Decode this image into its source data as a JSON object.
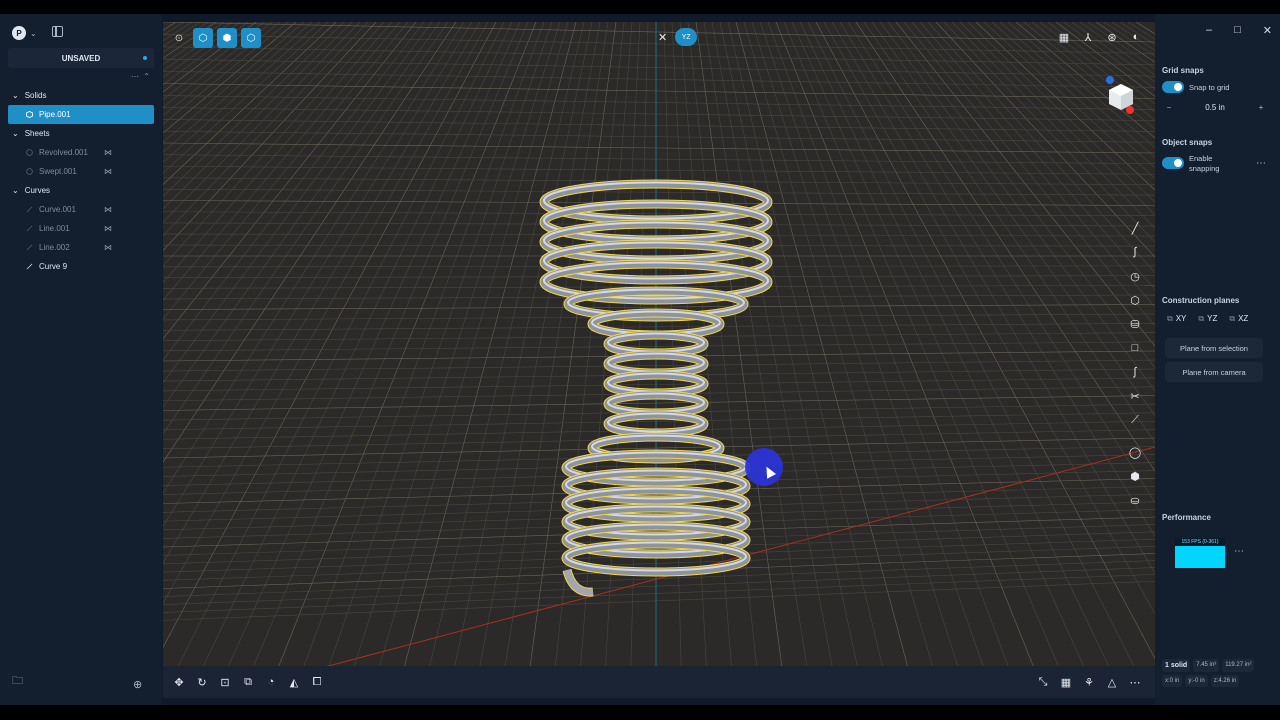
{
  "app": {
    "user_initial": "P",
    "document_title": "UNSAVED"
  },
  "tree": {
    "groups": [
      {
        "label": "Solids"
      },
      {
        "label": "Sheets"
      },
      {
        "label": "Curves"
      }
    ],
    "items": [
      {
        "label": "Pipe.001"
      },
      {
        "label": "Revolved.001"
      },
      {
        "label": "Swept.001"
      },
      {
        "label": "Curve.001"
      },
      {
        "label": "Line.001"
      },
      {
        "label": "Line.002"
      },
      {
        "label": "Curve 9"
      }
    ]
  },
  "viewport": {
    "plane_chip": "YZ"
  },
  "panel": {
    "grid_snaps": "Grid snaps",
    "snap_to_grid": "Snap to grid",
    "grid_size": "0.5 in",
    "object_snaps": "Object snaps",
    "enable_snapping": "Enable snapping",
    "construction_planes": "Construction planes",
    "plane_xy": "XY",
    "plane_yz": "YZ",
    "plane_xz": "XZ",
    "plane_from_selection": "Plane from selection",
    "plane_from_camera": "Plane from camera",
    "performance": "Performance",
    "fps": "153 FPS (0-361)"
  },
  "stats": {
    "solids": "1 solid",
    "volume": "7.45 in³",
    "area": "119.27 in²",
    "x": "x:0 in",
    "y": "y:-0 in",
    "z": "z:4.26 in"
  },
  "colors": {
    "accent": "#1f8fc7",
    "selection_outline": "#f2d74a",
    "perf_graph": "#00d6ff"
  }
}
